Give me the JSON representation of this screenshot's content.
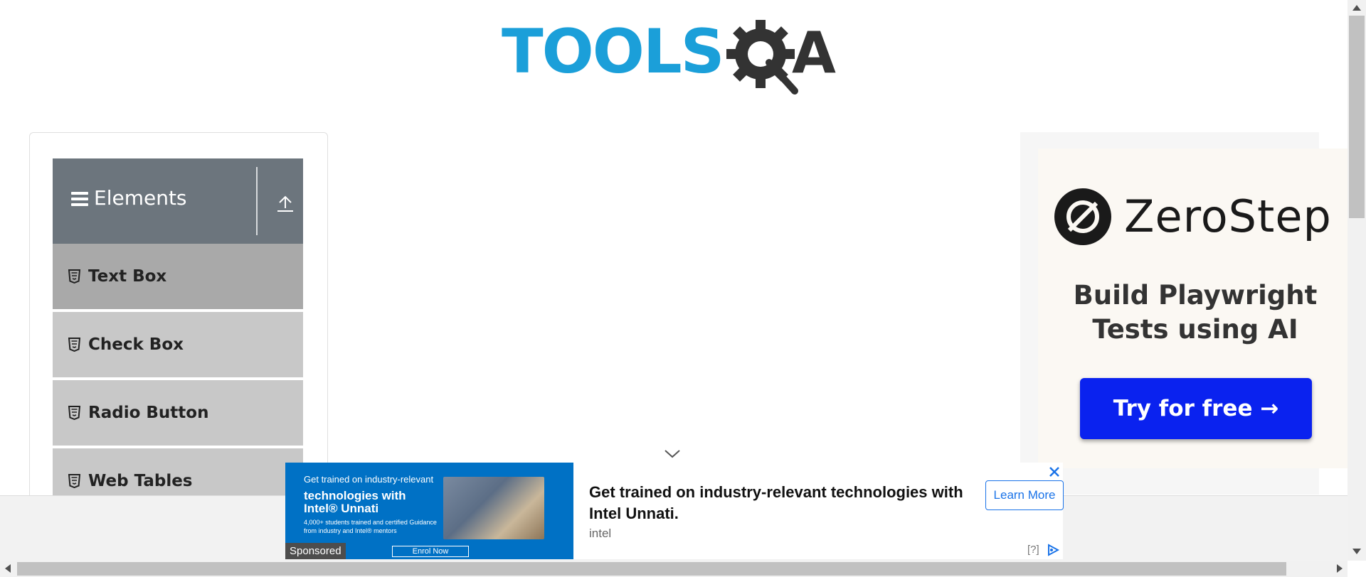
{
  "header": {
    "logo_text_left": "TOOLS",
    "logo_text_right": "A",
    "logo_colors": {
      "tools": "#1b9fd9",
      "qa": "#333333"
    }
  },
  "sidebar": {
    "group_title": "Elements",
    "items": [
      {
        "label": "Text Box",
        "active": true
      },
      {
        "label": "Check Box",
        "active": false
      },
      {
        "label": "Radio Button",
        "active": false
      },
      {
        "label": "Web Tables",
        "active": false
      }
    ],
    "colors": {
      "header": "#6c757d",
      "item": "#c8c8c8",
      "active_item": "#a9a9a9"
    }
  },
  "right_ad": {
    "brand": "ZeroStep",
    "tagline": "Build Playwright Tests using AI",
    "cta": "Try for free →",
    "cta_color": "#0a22ef"
  },
  "sticky_ad": {
    "image_line1": "Get trained on industry-relevant",
    "image_line2": "technologies with Intel® Unnati",
    "image_line3": "4,000+ students trained and certified Guidance from industry and Intel® mentors",
    "image_button": "Enrol Now",
    "sponsored": "Sponsored",
    "headline": "Get trained on industry-relevant technologies with Intel Unnati.",
    "brand": "intel",
    "learn_more": "Learn More",
    "info": "[?]",
    "accent_color": "#1a73e8"
  }
}
